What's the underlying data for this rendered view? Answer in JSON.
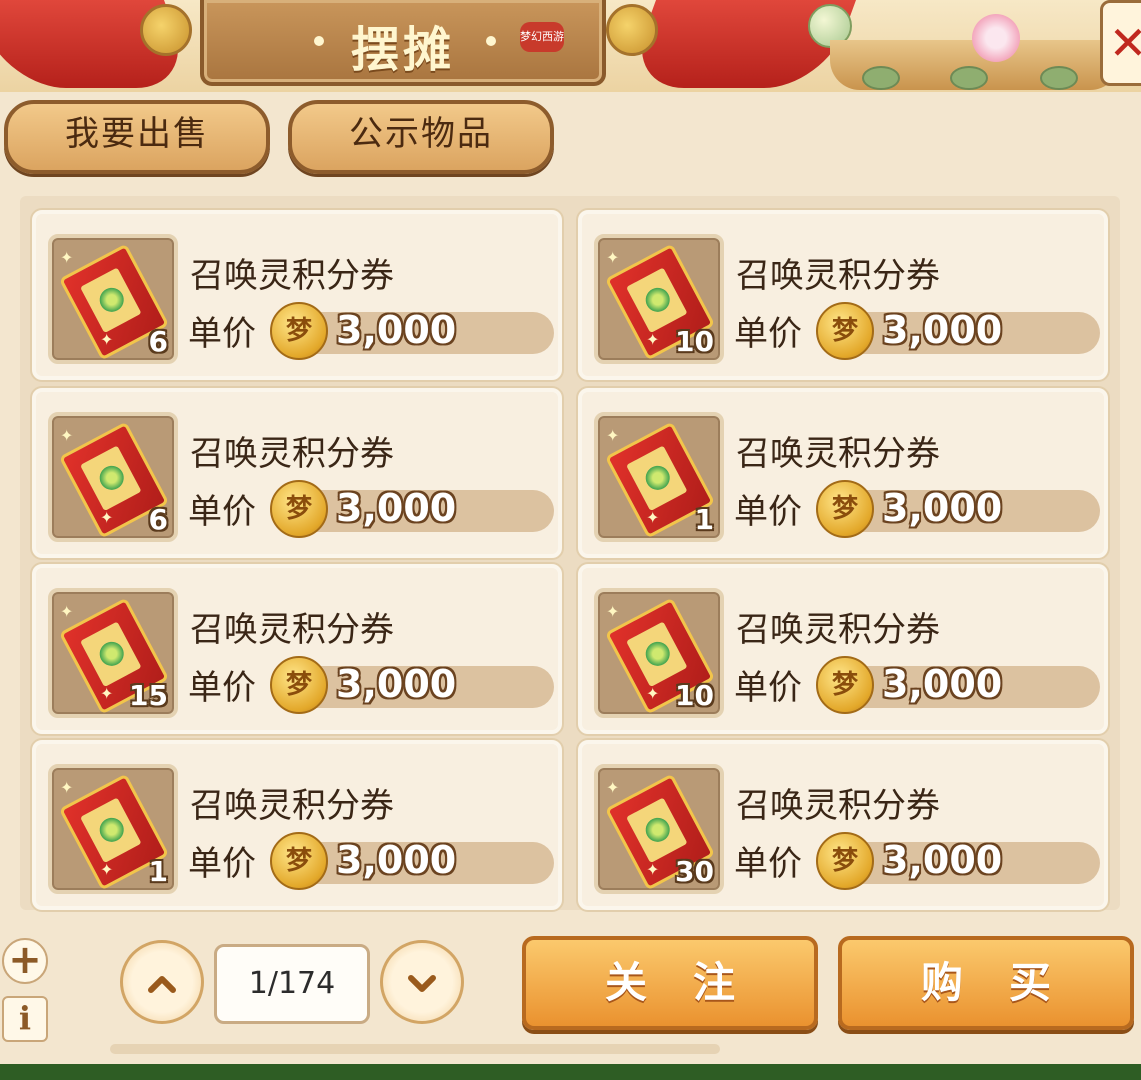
{
  "window": {
    "title": "摆摊",
    "seal": "梦幻西游",
    "close": "✕"
  },
  "tabs": [
    {
      "label": "我要出售"
    },
    {
      "label": "公示物品"
    }
  ],
  "items": [
    {
      "name": "召唤灵积分券",
      "price_label": "单价",
      "price": "3,000",
      "count": "6"
    },
    {
      "name": "召唤灵积分券",
      "price_label": "单价",
      "price": "3,000",
      "count": "10"
    },
    {
      "name": "召唤灵积分券",
      "price_label": "单价",
      "price": "3,000",
      "count": "6"
    },
    {
      "name": "召唤灵积分券",
      "price_label": "单价",
      "price": "3,000",
      "count": "1"
    },
    {
      "name": "召唤灵积分券",
      "price_label": "单价",
      "price": "3,000",
      "count": "15"
    },
    {
      "name": "召唤灵积分券",
      "price_label": "单价",
      "price": "3,000",
      "count": "10"
    },
    {
      "name": "召唤灵积分券",
      "price_label": "单价",
      "price": "3,000",
      "count": "1"
    },
    {
      "name": "召唤灵积分券",
      "price_label": "单价",
      "price": "3,000",
      "count": "30"
    }
  ],
  "pagination": {
    "page": "1/174",
    "up": "⌃",
    "down": "⌄"
  },
  "actions": {
    "follow": "关注",
    "buy": "购买"
  },
  "side": {
    "add": "+",
    "info": "i"
  },
  "icons": {
    "coin": "梦"
  },
  "colors": {
    "accent": "#ea922f",
    "ribbon": "#c8261e",
    "panel": "#f3e6cf"
  }
}
